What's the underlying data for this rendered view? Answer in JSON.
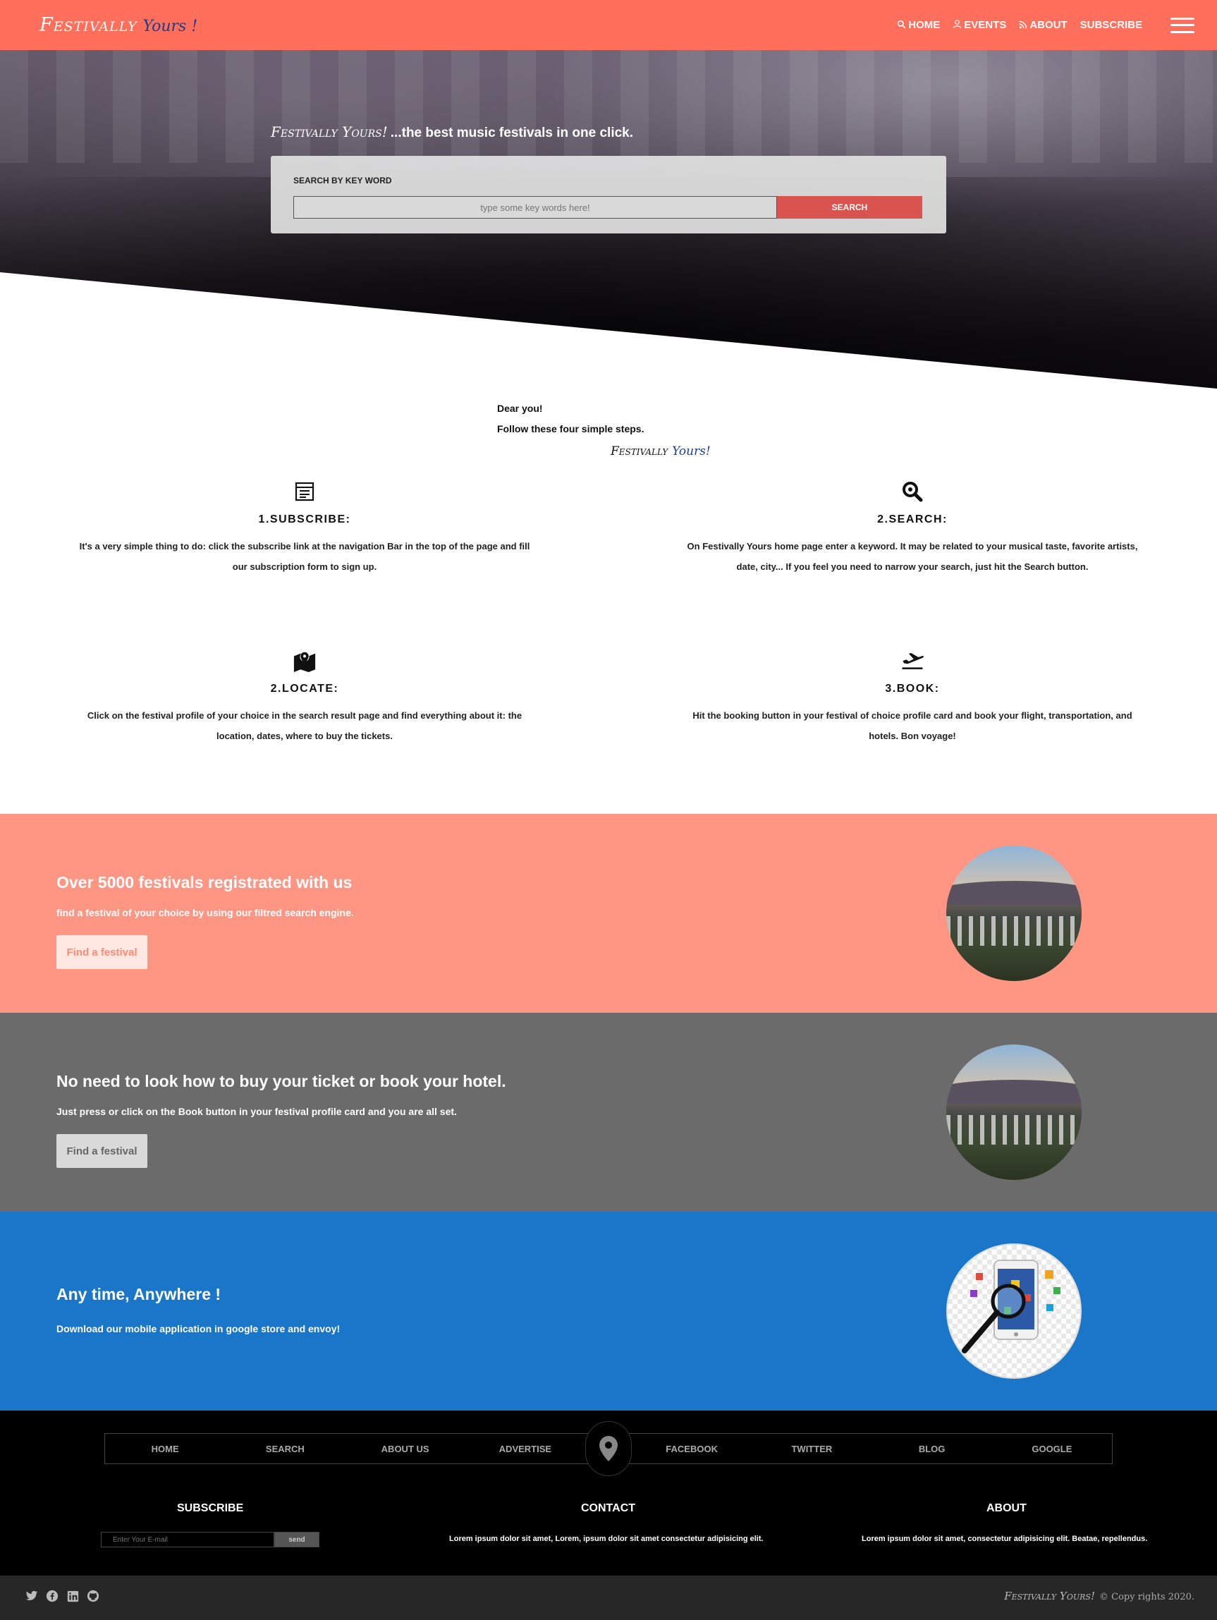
{
  "brand": {
    "main": "Festivally",
    "sub": "Yours !"
  },
  "nav": {
    "home": "HOME",
    "events": "EVENTS",
    "about": "ABOUT",
    "subscribe": "SUBSCRIBE"
  },
  "hero": {
    "brand": "Festivally Yours!",
    "tagline": "...the best music festivals in one click.",
    "search_label": "SEARCH BY KEY WORD",
    "search_placeholder": "type some key words here!",
    "search_button": "SEARCH"
  },
  "intro": {
    "line1": "Dear you!",
    "line2": "Follow these four simple steps.",
    "brand_a": "Festivally",
    "brand_b": "Yours!"
  },
  "steps": [
    {
      "title": "1.SUBSCRIBE:",
      "text": "It's a very simple thing to do: click the subscribe link at the navigation Bar in the top of the page and fill our subscription form to sign up.",
      "icon": "newsletter-icon"
    },
    {
      "title": "2.SEARCH:",
      "text": "On Festivally Yours home page enter a keyword. It may be related to your musical taste, favorite artists, date, city... If you feel you need to narrow your search, just hit the Search button.",
      "icon": "search-icon"
    },
    {
      "title": "2.LOCATE:",
      "text": "Click on the festival profile of your choice in the search result page and find everything about it: the location, dates, where to buy the tickets.",
      "icon": "map-icon"
    },
    {
      "title": "3.BOOK:",
      "text": "Hit the booking button in your festival of choice profile card and book your flight, transportation, and hotels. Bon voyage!",
      "icon": "plane-icon"
    }
  ],
  "bands": [
    {
      "title": "Over 5000 festivals registrated with us",
      "text": "find a festival of your choice by using our filtred search engine.",
      "button": "Find a festival",
      "color": "#ff9684"
    },
    {
      "title": "No need to look how to buy your ticket or book your hotel.",
      "text": "Just press or click on the Book button in your festival profile card and you are all set.",
      "button": "Find a festival",
      "color": "#6b6b6b"
    },
    {
      "title": "Any time, Anywhere !",
      "text": "Download our mobile application in google store and envoy!",
      "color": "#1a76c8"
    }
  ],
  "footer": {
    "nav": [
      "HOME",
      "SEARCH",
      "ABOUT US",
      "ADVERTISE",
      "FACEBOOK",
      "TWITTER",
      "BLOG",
      "GOOGLE"
    ],
    "subscribe_title": "SUBSCRIBE",
    "email_placeholder": "Enter Your E-mail",
    "send_button": "send",
    "contact_title": "CONTACT",
    "contact_text": "Lorem ipsum dolor sit amet, Lorem, ipsum dolor sit amet consectetur adipisicing elit.",
    "about_title": "ABOUT",
    "about_text": "Lorem ipsum dolor sit amet, consectetur adipisicing elit. Beatae, repellendus."
  },
  "bottom": {
    "brand": "Festivally Yours!",
    "copyright": "© Copy rights 2020.",
    "social_icons": [
      "twitter-icon",
      "facebook-icon",
      "linkedin-icon",
      "github-icon"
    ]
  },
  "colors": {
    "nav": "#ff6f5b",
    "accent_red": "#d9534f",
    "brand_blue": "#1b3f8c"
  }
}
